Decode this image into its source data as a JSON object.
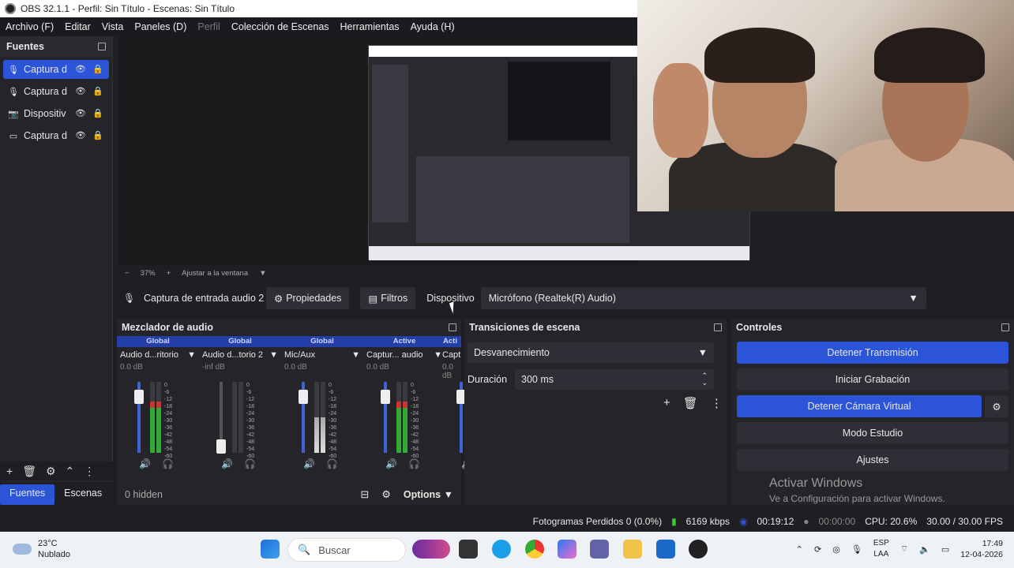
{
  "window": {
    "title": "OBS 32.1.1 - Perfil: Sin Título - Escenas: Sin Título"
  },
  "menu": [
    {
      "label": "Archivo (F)",
      "enabled": true
    },
    {
      "label": "Editar",
      "enabled": true
    },
    {
      "label": "Vista",
      "enabled": true
    },
    {
      "label": "Paneles (D)",
      "enabled": true
    },
    {
      "label": "Perfil",
      "enabled": false
    },
    {
      "label": "Colección de Escenas",
      "enabled": true
    },
    {
      "label": "Herramientas",
      "enabled": true
    },
    {
      "label": "Ayuda (H)",
      "enabled": true
    }
  ],
  "sources": {
    "title": "Fuentes",
    "items": [
      {
        "label": "Captura d",
        "icon": "microphone-icon",
        "selected": true
      },
      {
        "label": "Captura d",
        "icon": "microphone-icon",
        "selected": false
      },
      {
        "label": "Dispositiv",
        "icon": "camera-icon",
        "selected": false
      },
      {
        "label": "Captura d",
        "icon": "monitor-icon",
        "selected": false
      }
    ]
  },
  "bottom_tabs": {
    "fuentes": "Fuentes",
    "escenas": "Escenas"
  },
  "zoom": {
    "minus": "−",
    "percent": "37%",
    "plus": "+",
    "fit": "Ajustar a la ventana"
  },
  "context": {
    "source_name": "Captura de entrada audio 2",
    "properties": "Propiedades",
    "filters": "Filtros",
    "device_label": "Dispositivo",
    "device_value": "Micrófono (Realtek(R) Audio)"
  },
  "mixer": {
    "title": "Mezclador de audio",
    "channels": [
      {
        "header": "Global",
        "name": "Audio d...ritorio",
        "db": "0.0 dB",
        "level": 0.82,
        "muted": false
      },
      {
        "header": "Global",
        "name": "Audio d...torio 2",
        "db": "-inf dB",
        "level": 0.12,
        "muted": true
      },
      {
        "header": "Global",
        "name": "Mic/Aux",
        "db": "0.0 dB",
        "level": 0.82,
        "muted": true
      },
      {
        "header": "Active",
        "name": "Captur... audio",
        "db": "0.0 dB",
        "level": 0.82,
        "muted": false
      },
      {
        "header": "Acti",
        "name": "Captur...ur",
        "db": "0.0 dB",
        "level": 0.82,
        "muted": true
      }
    ],
    "ticks": [
      "0",
      "-6",
      "-12",
      "-18",
      "-24",
      "-30",
      "-36",
      "-42",
      "-48",
      "-54",
      "-60"
    ],
    "hidden": "0 hidden",
    "options": "Options"
  },
  "transitions": {
    "title": "Transiciones de escena",
    "selected": "Desvanecimiento",
    "duration_label": "Duración",
    "duration_value": "300 ms"
  },
  "controls": {
    "title": "Controles",
    "stop_stream": "Detener Transmisión",
    "start_recording": "Iniciar Grabación",
    "stop_virtual_cam": "Detener Cámara Virtual",
    "studio_mode": "Modo Estudio",
    "settings": "Ajustes"
  },
  "watermark": {
    "line1": "Activar Windows",
    "line2": "Ve a Configuración para activar Windows."
  },
  "status": {
    "dropped": "Fotogramas Perdidos 0 (0.0%)",
    "bitrate": "6169 kbps",
    "stream_time": "00:19:12",
    "rec_time": "00:00:00",
    "cpu": "CPU: 20.6%",
    "fps": "30.00 / 30.00 FPS"
  },
  "taskbar": {
    "weather_temp": "23°C",
    "weather_desc": "Nublado",
    "search": "Buscar",
    "lang1": "ESP",
    "lang2": "LAA",
    "time": "17:49",
    "date": "12-04-2026"
  }
}
